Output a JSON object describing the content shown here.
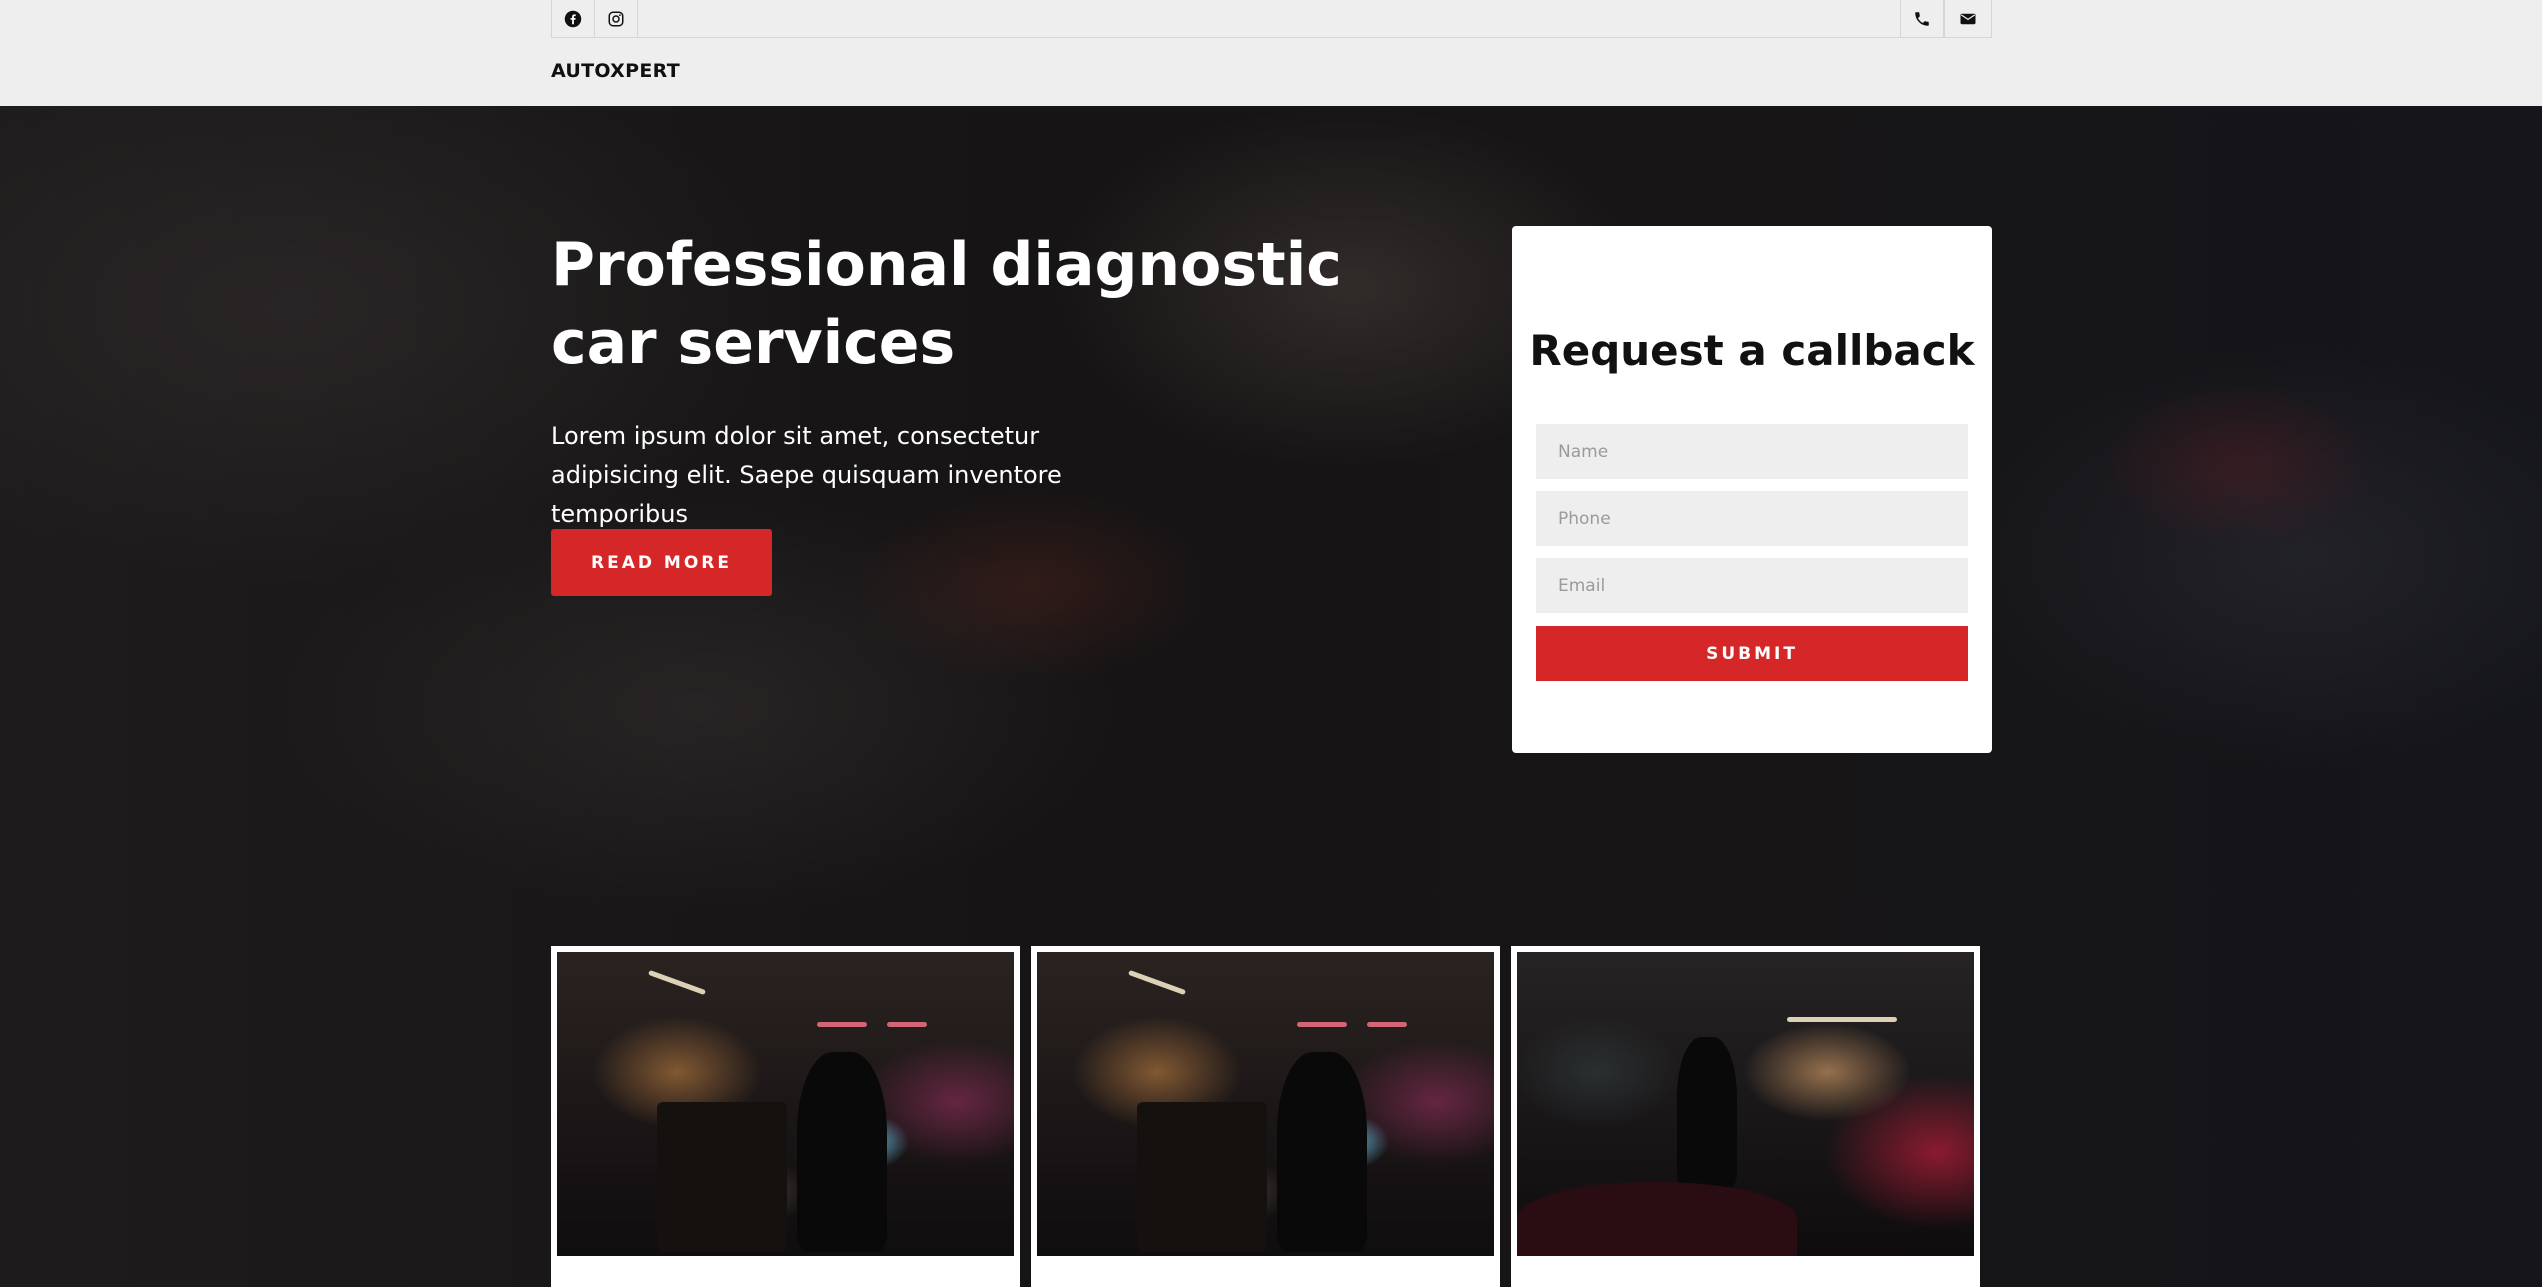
{
  "brand": "AUTOXPERT",
  "topbar": {
    "left_icons": [
      "facebook-icon",
      "instagram-icon"
    ],
    "right_icons": [
      "phone-icon",
      "mail-icon"
    ]
  },
  "hero": {
    "title": "Professional diagnostic car services",
    "description": "Lorem ipsum dolor sit amet, consectetur adipisicing elit. Saepe quisquam inventore temporibus",
    "cta_label": "READ MORE"
  },
  "form": {
    "title": "Request a callback",
    "name_placeholder": "Name",
    "phone_placeholder": "Phone",
    "email_placeholder": "Email",
    "submit_label": "SUBMIT"
  },
  "colors": {
    "accent": "#d62728",
    "topbar_bg": "#efeeee",
    "input_bg": "#efeeee"
  }
}
